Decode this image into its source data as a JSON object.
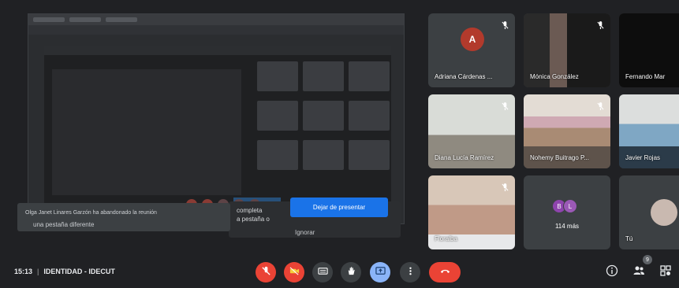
{
  "toast": {
    "message": "Olga Janet Linares Garzón ha abandonado la reunión"
  },
  "presentation": {
    "stop_label": "Dejar de presentar",
    "popup_line1": "completa",
    "popup_line2": "a pestaña o",
    "ignore_label": "Ignorar",
    "side_text": "una pestaña diferente"
  },
  "participants": [
    {
      "name": "Adriana Cárdenas ...",
      "type": "avatar",
      "initial": "A",
      "avatar_color": "#b23a2c"
    },
    {
      "name": "Mónica González",
      "type": "video"
    },
    {
      "name": "Fernando Mar",
      "type": "video"
    },
    {
      "name": "Diana Lucía Ramírez",
      "type": "video"
    },
    {
      "name": "Nohemy Buitrago P...",
      "type": "video"
    },
    {
      "name": "Javier Rojas",
      "type": "video"
    },
    {
      "name": "Floralba",
      "type": "video"
    },
    {
      "name": "114 más",
      "type": "more",
      "initials": [
        "B",
        "L"
      ]
    },
    {
      "name": "Tú",
      "type": "self"
    }
  ],
  "meeting": {
    "time": "15:13",
    "separator": "|",
    "title": "IDENTIDAD - IDECUT"
  },
  "controls": [
    {
      "name": "mic-off",
      "icon": "mic-off-icon",
      "color": "#ea4335"
    },
    {
      "name": "camera-off",
      "icon": "camera-off-icon",
      "color": "#ea4335"
    },
    {
      "name": "captions",
      "icon": "captions-icon",
      "color": "#3c4043"
    },
    {
      "name": "raise-hand",
      "icon": "hand-icon",
      "color": "#3c4043"
    },
    {
      "name": "present",
      "icon": "present-icon",
      "color": "#8ab4f8"
    },
    {
      "name": "more-options",
      "icon": "more-vert-icon",
      "color": "#3c4043"
    },
    {
      "name": "leave-call",
      "icon": "hangup-icon",
      "color": "#ea4335"
    }
  ],
  "right_controls": {
    "participants_badge": "9"
  }
}
